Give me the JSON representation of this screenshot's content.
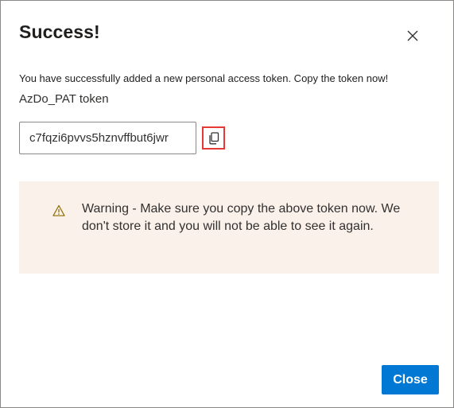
{
  "dialog": {
    "title": "Success!",
    "close_icon": "close-icon",
    "message": "You have successfully added a new personal access token. Copy the token now!",
    "token_name": "AzDo_PAT token",
    "token_value": "c7fqzi6pvvs5hznvffbut6jwr",
    "copy_icon": "copy-icon",
    "warning": {
      "icon": "warning-icon",
      "text": "Warning - Make sure you copy the above token now. We don't store it and you will not be able to see it again."
    },
    "close_button_label": "Close"
  },
  "colors": {
    "primary": "#0078d4",
    "warning_background": "#fbf1eb",
    "highlight_border": "#e53935",
    "warning_icon": "#8a6d00"
  }
}
